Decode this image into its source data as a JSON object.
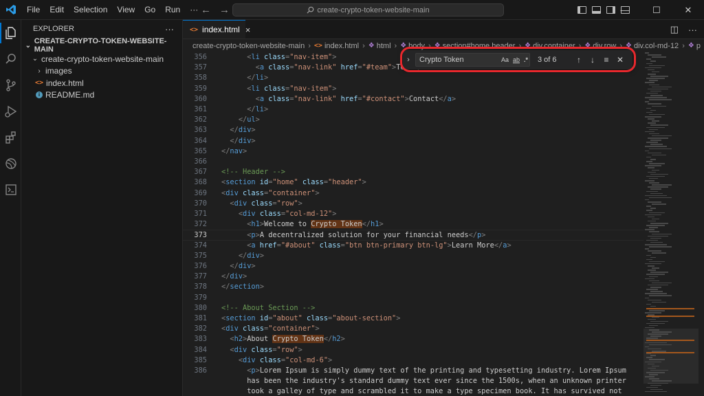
{
  "menu": [
    "File",
    "Edit",
    "Selection",
    "View",
    "Go",
    "Run",
    "···"
  ],
  "command_center": {
    "text": "create-crypto-token-website-main"
  },
  "sidebar": {
    "title": "EXPLORER",
    "more": "···",
    "section": "CREATE-CRYPTO-TOKEN-WEBSITE-MAIN",
    "tree": [
      {
        "label": "create-crypto-token-website-main",
        "kind": "folder-open"
      },
      {
        "label": "images",
        "kind": "folder"
      },
      {
        "label": "index.html",
        "kind": "html"
      },
      {
        "label": "README.md",
        "kind": "info"
      }
    ]
  },
  "tab": {
    "label": "index.html",
    "close": "×"
  },
  "breadcrumbs": [
    "create-crypto-token-website-main",
    "index.html",
    "html",
    "body",
    "section#home.header",
    "div.container",
    "div.row",
    "div.col-md-12",
    "p"
  ],
  "find": {
    "value": "Crypto Token",
    "case_label": "Aa",
    "word_label": "ab",
    "regex_label": ".*",
    "count": "3 of 6"
  },
  "code": {
    "current_line": "373",
    "lines": [
      {
        "n": "356",
        "text": "      <li class=\"nav-item\">"
      },
      {
        "n": "357",
        "text": "        <a class=\"nav-link\" href=\"#team\">Team</a>"
      },
      {
        "n": "358",
        "text": "      </li>"
      },
      {
        "n": "359",
        "text": "      <li class=\"nav-item\">"
      },
      {
        "n": "360",
        "text": "        <a class=\"nav-link\" href=\"#contact\">Contact</a>"
      },
      {
        "n": "361",
        "text": "      </li>"
      },
      {
        "n": "362",
        "text": "    </ul>"
      },
      {
        "n": "363",
        "text": "  </div>"
      },
      {
        "n": "364",
        "text": "  </div>"
      },
      {
        "n": "365",
        "text": "</nav>"
      },
      {
        "n": "366",
        "text": ""
      },
      {
        "n": "367",
        "text": "<!-- Header -->"
      },
      {
        "n": "368",
        "text": "<section id=\"home\" class=\"header\">"
      },
      {
        "n": "369",
        "text": "<div class=\"container\">"
      },
      {
        "n": "370",
        "text": "  <div class=\"row\">"
      },
      {
        "n": "371",
        "text": "    <div class=\"col-md-12\">"
      },
      {
        "n": "372",
        "text": "      <h1>Welcome to Crypto Token</h1>"
      },
      {
        "n": "373",
        "text": "      <p>A decentralized solution for your financial needs</p>"
      },
      {
        "n": "374",
        "text": "      <a href=\"#about\" class=\"btn btn-primary btn-lg\">Learn More</a>"
      },
      {
        "n": "375",
        "text": "    </div>"
      },
      {
        "n": "376",
        "text": "  </div>"
      },
      {
        "n": "377",
        "text": "</div>"
      },
      {
        "n": "378",
        "text": "</section>"
      },
      {
        "n": "379",
        "text": ""
      },
      {
        "n": "380",
        "text": "<!-- About Section -->"
      },
      {
        "n": "381",
        "text": "<section id=\"about\" class=\"about-section\">"
      },
      {
        "n": "382",
        "text": "<div class=\"container\">"
      },
      {
        "n": "383",
        "text": "  <h2>About Crypto Token</h2>"
      },
      {
        "n": "384",
        "text": "  <div class=\"row\">"
      },
      {
        "n": "385",
        "text": "    <div class=\"col-md-6\">"
      },
      {
        "n": "386",
        "text": "      <p>Lorem Ipsum is simply dummy text of the printing and typesetting industry. Lorem Ipsum"
      },
      {
        "n": "",
        "text": "      has been the industry's standard dummy text ever since the 1500s, when an unknown printer"
      },
      {
        "n": "",
        "text": "      took a galley of type and scrambled it to make a type specimen book. It has survived not"
      }
    ]
  },
  "colors": {
    "accent": "#0078d4",
    "find_highlight": "#623315",
    "annotation_outline": "#e8282d"
  }
}
